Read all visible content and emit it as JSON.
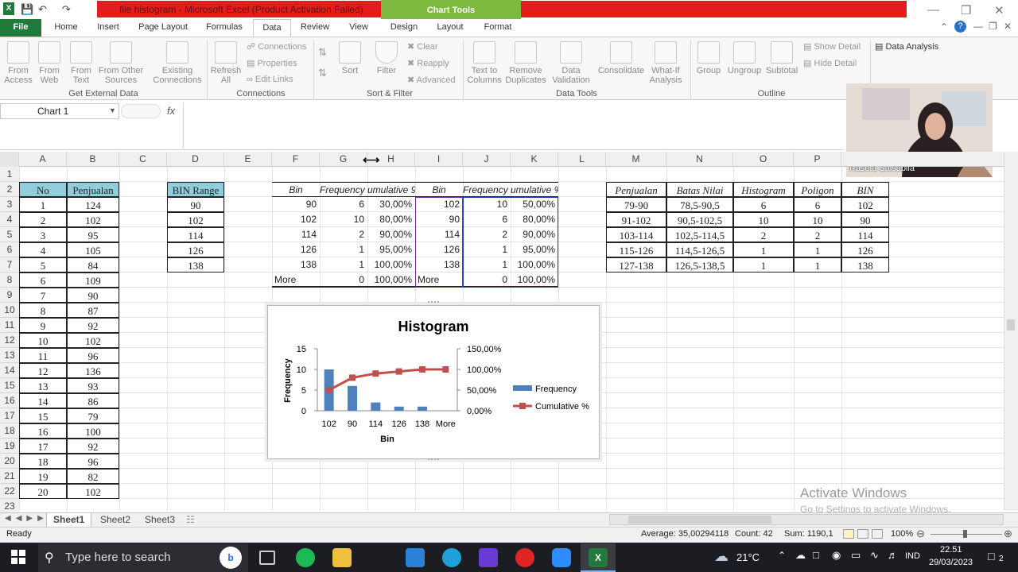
{
  "window": {
    "title": "file histogram - Microsoft Excel (Product Activation Failed)",
    "context_tab_group": "Chart Tools"
  },
  "ribbon_tabs": [
    "File",
    "Home",
    "Insert",
    "Page Layout",
    "Formulas",
    "Data",
    "Review",
    "View",
    "Design",
    "Layout",
    "Format"
  ],
  "ribbon": {
    "get_external": {
      "label": "Get External Data",
      "buttons": [
        "From Access",
        "From Web",
        "From Text",
        "From Other Sources",
        "Existing Connections"
      ]
    },
    "connections": {
      "label": "Connections",
      "refresh": "Refresh All",
      "items": [
        "Connections",
        "Properties",
        "Edit Links"
      ]
    },
    "sort_filter": {
      "label": "Sort & Filter",
      "sort": "Sort",
      "filter": "Filter",
      "items": [
        "Clear",
        "Reapply",
        "Advanced"
      ]
    },
    "data_tools": {
      "label": "Data Tools",
      "buttons": [
        "Text to Columns",
        "Remove Duplicates",
        "Data Validation",
        "Consolidate",
        "What-If Analysis"
      ]
    },
    "outline": {
      "label": "Outline",
      "buttons": [
        "Group",
        "Ungroup",
        "Subtotal"
      ],
      "items": [
        "Show Detail",
        "Hide Detail"
      ]
    },
    "analysis": {
      "data_analysis": "Data Analysis"
    }
  },
  "formula_bar": {
    "name_box": "Chart 1",
    "fx": "fx",
    "formula": ""
  },
  "webcam": {
    "name": "Rasela Salsabila"
  },
  "columns": [
    "A",
    "B",
    "C",
    "D",
    "E",
    "F",
    "G",
    "H",
    "I",
    "J",
    "K",
    "L",
    "M",
    "N",
    "O",
    "P"
  ],
  "rows": [
    "1",
    "2",
    "3",
    "4",
    "5",
    "6",
    "7",
    "8",
    "9",
    "10",
    "11",
    "12",
    "13",
    "14",
    "15",
    "16",
    "17",
    "18",
    "19",
    "20",
    "21",
    "22",
    "23"
  ],
  "table1": {
    "headers": [
      "No",
      "Penjualan"
    ],
    "rows": [
      [
        "1",
        "124"
      ],
      [
        "2",
        "102"
      ],
      [
        "3",
        "95"
      ],
      [
        "4",
        "105"
      ],
      [
        "5",
        "84"
      ],
      [
        "6",
        "109"
      ],
      [
        "7",
        "90"
      ],
      [
        "8",
        "87"
      ],
      [
        "9",
        "92"
      ],
      [
        "10",
        "102"
      ],
      [
        "11",
        "96"
      ],
      [
        "12",
        "136"
      ],
      [
        "13",
        "93"
      ],
      [
        "14",
        "86"
      ],
      [
        "15",
        "79"
      ],
      [
        "16",
        "100"
      ],
      [
        "17",
        "92"
      ],
      [
        "18",
        "96"
      ],
      [
        "19",
        "82"
      ],
      [
        "20",
        "102"
      ]
    ]
  },
  "bin_range": {
    "header": "BIN Range",
    "values": [
      "90",
      "102",
      "114",
      "126",
      "138"
    ]
  },
  "hist1": {
    "headers": [
      "Bin",
      "Frequency",
      "umulative 9"
    ],
    "rows": [
      [
        "90",
        "6",
        "30,00%"
      ],
      [
        "102",
        "10",
        "80,00%"
      ],
      [
        "114",
        "2",
        "90,00%"
      ],
      [
        "126",
        "1",
        "95,00%"
      ],
      [
        "138",
        "1",
        "100,00%"
      ],
      [
        "More",
        "0",
        "100,00%"
      ]
    ]
  },
  "hist2": {
    "headers": [
      "Bin",
      "Frequency",
      "umulative %"
    ],
    "rows": [
      [
        "102",
        "10",
        "50,00%"
      ],
      [
        "90",
        "6",
        "80,00%"
      ],
      [
        "114",
        "2",
        "90,00%"
      ],
      [
        "126",
        "1",
        "95,00%"
      ],
      [
        "138",
        "1",
        "100,00%"
      ],
      [
        "More",
        "0",
        "100,00%"
      ]
    ]
  },
  "summary": {
    "headers": [
      "Penjualan",
      "Batas Nilai",
      "Histogram",
      "Poligon",
      "BIN"
    ],
    "rows": [
      [
        "79-90",
        "78,5-90,5",
        "6",
        "6",
        "102"
      ],
      [
        "91-102",
        "90,5-102,5",
        "10",
        "10",
        "90"
      ],
      [
        "103-114",
        "102,5-114,5",
        "2",
        "2",
        "114"
      ],
      [
        "115-126",
        "114,5-126,5",
        "1",
        "1",
        "126"
      ],
      [
        "127-138",
        "126,5-138,5",
        "1",
        "1",
        "138"
      ]
    ]
  },
  "chart_data": {
    "type": "bar",
    "title": "Histogram",
    "categories": [
      "102",
      "90",
      "114",
      "126",
      "138",
      "More"
    ],
    "xlabel": "Bin",
    "ylabel": "Frequency",
    "ylim": [
      0,
      15
    ],
    "yticks": [
      "0",
      "5",
      "10",
      "15"
    ],
    "y2lim": [
      0,
      150
    ],
    "y2ticks": [
      "0,00%",
      "50,00%",
      "100,00%",
      "150,00%"
    ],
    "series": [
      {
        "name": "Frequency",
        "kind": "bar",
        "color": "#4f81bd",
        "values": [
          10,
          6,
          2,
          1,
          1,
          0
        ]
      },
      {
        "name": "Cumulative %",
        "kind": "line",
        "color": "#c0504d",
        "values": [
          50,
          80,
          90,
          95,
          100,
          100
        ]
      }
    ],
    "legend_position": "right"
  },
  "sheets": [
    "Sheet1",
    "Sheet2",
    "Sheet3"
  ],
  "status": {
    "mode": "Ready",
    "average": "Average: 35,00294118",
    "count": "Count: 42",
    "sum": "Sum: 1190,1",
    "zoom": "100%"
  },
  "watermark": {
    "line1": "Activate Windows",
    "line2": "Go to Settings to activate Windows."
  },
  "taskbar": {
    "search_placeholder": "Type here to search",
    "weather": "21°C",
    "lang": "IND",
    "time": "22.51",
    "date": "29/03/2023",
    "notif": "2"
  }
}
